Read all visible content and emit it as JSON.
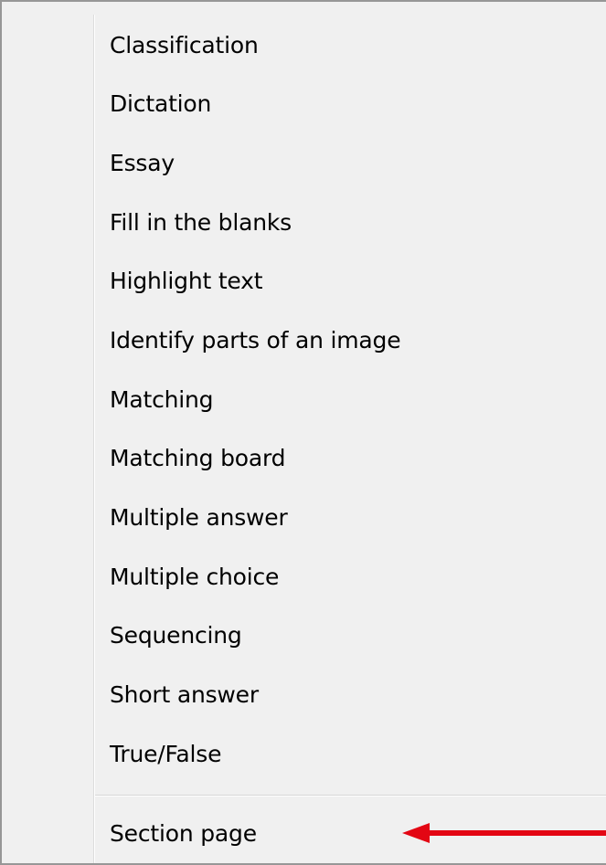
{
  "menu": {
    "items": [
      {
        "label": "Classification"
      },
      {
        "label": "Dictation"
      },
      {
        "label": "Essay"
      },
      {
        "label": "Fill in the blanks"
      },
      {
        "label": "Highlight text"
      },
      {
        "label": "Identify parts of an image"
      },
      {
        "label": "Matching"
      },
      {
        "label": "Matching board"
      },
      {
        "label": "Multiple answer"
      },
      {
        "label": "Multiple choice"
      },
      {
        "label": "Sequencing"
      },
      {
        "label": "Short answer"
      },
      {
        "label": "True/False"
      }
    ],
    "section_item": {
      "label": "Section page"
    }
  },
  "annotation": {
    "arrow_color": "#e30613",
    "icon": "left-arrow-icon"
  }
}
